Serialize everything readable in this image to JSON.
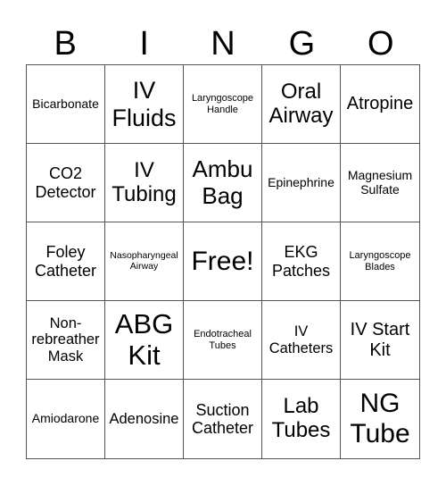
{
  "header": {
    "letters": [
      "B",
      "I",
      "N",
      "G",
      "O"
    ]
  },
  "cells": [
    "Bicarbonate",
    "IV Fluids",
    "Laryngoscope Handle",
    "Oral Airway",
    "Atropine",
    "CO2 Detector",
    "IV Tubing",
    "Ambu Bag",
    "Epinephrine",
    "Magnesium Sulfate",
    "Foley Catheter",
    "Nasopharyngeal Airway",
    "Free!",
    "EKG Patches",
    "Laryngoscope Blades",
    "Non-rebreather Mask",
    "ABG Kit",
    "Endotracheal Tubes",
    "IV Catheters",
    "IV Start Kit",
    "Amiodarone",
    "Adenosine",
    "Suction Catheter",
    "Lab Tubes",
    "NG Tube"
  ],
  "colors": {
    "border": "#555555",
    "text": "#000000",
    "background": "#ffffff"
  }
}
